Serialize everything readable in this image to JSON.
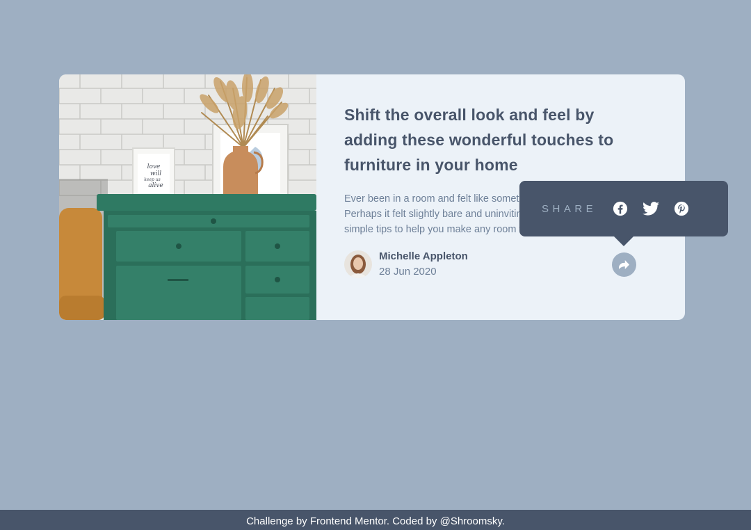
{
  "article": {
    "headline": "Shift the overall look and feel by adding these wonderful touches to furniture in your home",
    "description": "Ever been in a room and felt like something was missing? Perhaps it felt slightly bare and uninviting. I've got some simple tips to help you make any room feel complete.",
    "image_note_text": "love will keep us alive"
  },
  "author": {
    "name": "Michelle Appleton",
    "date": "28 Jun 2020"
  },
  "share": {
    "label": "SHARE",
    "networks": [
      "facebook-icon",
      "twitter-icon",
      "pinterest-icon"
    ],
    "button_icon": "share-icon"
  },
  "footer": {
    "text": "Challenge by Frontend Mentor. Coded by @Shroomsky."
  },
  "colors": {
    "background": "#9eafc2",
    "card": "#ecf2f8",
    "dark": "#48556a",
    "muted": "#6e8098"
  }
}
